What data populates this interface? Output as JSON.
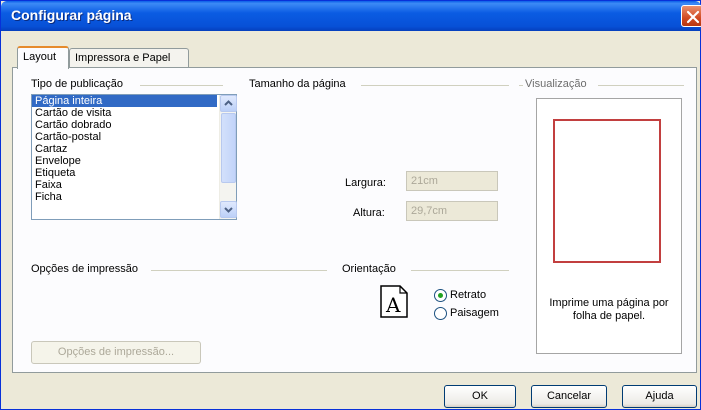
{
  "window": {
    "title": "Configurar página"
  },
  "tabs": [
    {
      "label": "Layout"
    },
    {
      "label": "Impressora e Papel"
    }
  ],
  "publication_type": {
    "label": "Tipo de publicação",
    "items": [
      "Página inteira",
      "Cartão de visita",
      "Cartão dobrado",
      "Cartão-postal",
      "Cartaz",
      "Envelope",
      "Etiqueta",
      "Faixa",
      "Ficha"
    ],
    "selected": "Página inteira"
  },
  "page_size": {
    "label": "Tamanho da página",
    "width_label": "Largura:",
    "width_value": "21cm",
    "height_label": "Altura:",
    "height_value": "29,7cm"
  },
  "print_options": {
    "label": "Opções de impressão",
    "button_label": "Opções de impressão..."
  },
  "orientation": {
    "label": "Orientação",
    "icon_glyph": "A",
    "portrait_label": "Retrato",
    "landscape_label": "Paisagem",
    "selected": "Retrato"
  },
  "preview": {
    "label": "Visualização",
    "caption": "Imprime uma página por folha de papel."
  },
  "buttons": {
    "ok": "OK",
    "cancel": "Cancelar",
    "help": "Ajuda"
  },
  "colors": {
    "accent": "#0a5fe8",
    "selection": "#316ac5",
    "page_border": "#c23f3f"
  }
}
